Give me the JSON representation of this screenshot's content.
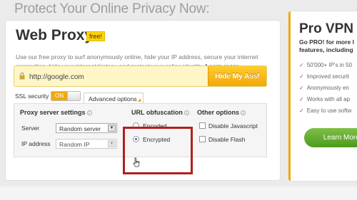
{
  "headline": "Protect Your Online Privacy Now:",
  "web_proxy": {
    "title": "Web Proxy",
    "badge": "free!",
    "description": "Use our free proxy to surf anonymously online, hide your IP address, secure your internet connection, hide your internet history, and protect your online identity.",
    "learn_more": "Learn more »",
    "url_value": "http://google.com",
    "hide_button": "Hide My Ass!",
    "ssl_label": "SSL security",
    "ssl_state": "ON",
    "advanced_tab": "Advanced options"
  },
  "proxy_settings": {
    "heading": "Proxy server settings",
    "server_label": "Server",
    "server_value": "Random server",
    "ip_label": "IP address",
    "ip_value": "Random IP"
  },
  "url_obfuscation": {
    "heading": "URL obfuscation",
    "options": [
      {
        "label": "Encoded",
        "checked": false
      },
      {
        "label": "Encrypted",
        "checked": true
      }
    ]
  },
  "other_options": {
    "heading": "Other options",
    "options": [
      {
        "label": "Disable Javascript",
        "checked": false
      },
      {
        "label": "Disable Flash",
        "checked": false
      }
    ]
  },
  "vpn": {
    "title": "Pro VPN",
    "subtitle_line1": "Go PRO! for more l",
    "subtitle_line2": "features, including",
    "features": [
      "50'000+ IP's in 50",
      "Improved securit",
      "Anonymously en",
      "Works with all ap",
      "Easy to use softw"
    ],
    "button": "Learn More and"
  },
  "colors": {
    "accent": "#f2a90d",
    "highlight": "#b21e1e",
    "cta_green": "#5aa52a"
  }
}
